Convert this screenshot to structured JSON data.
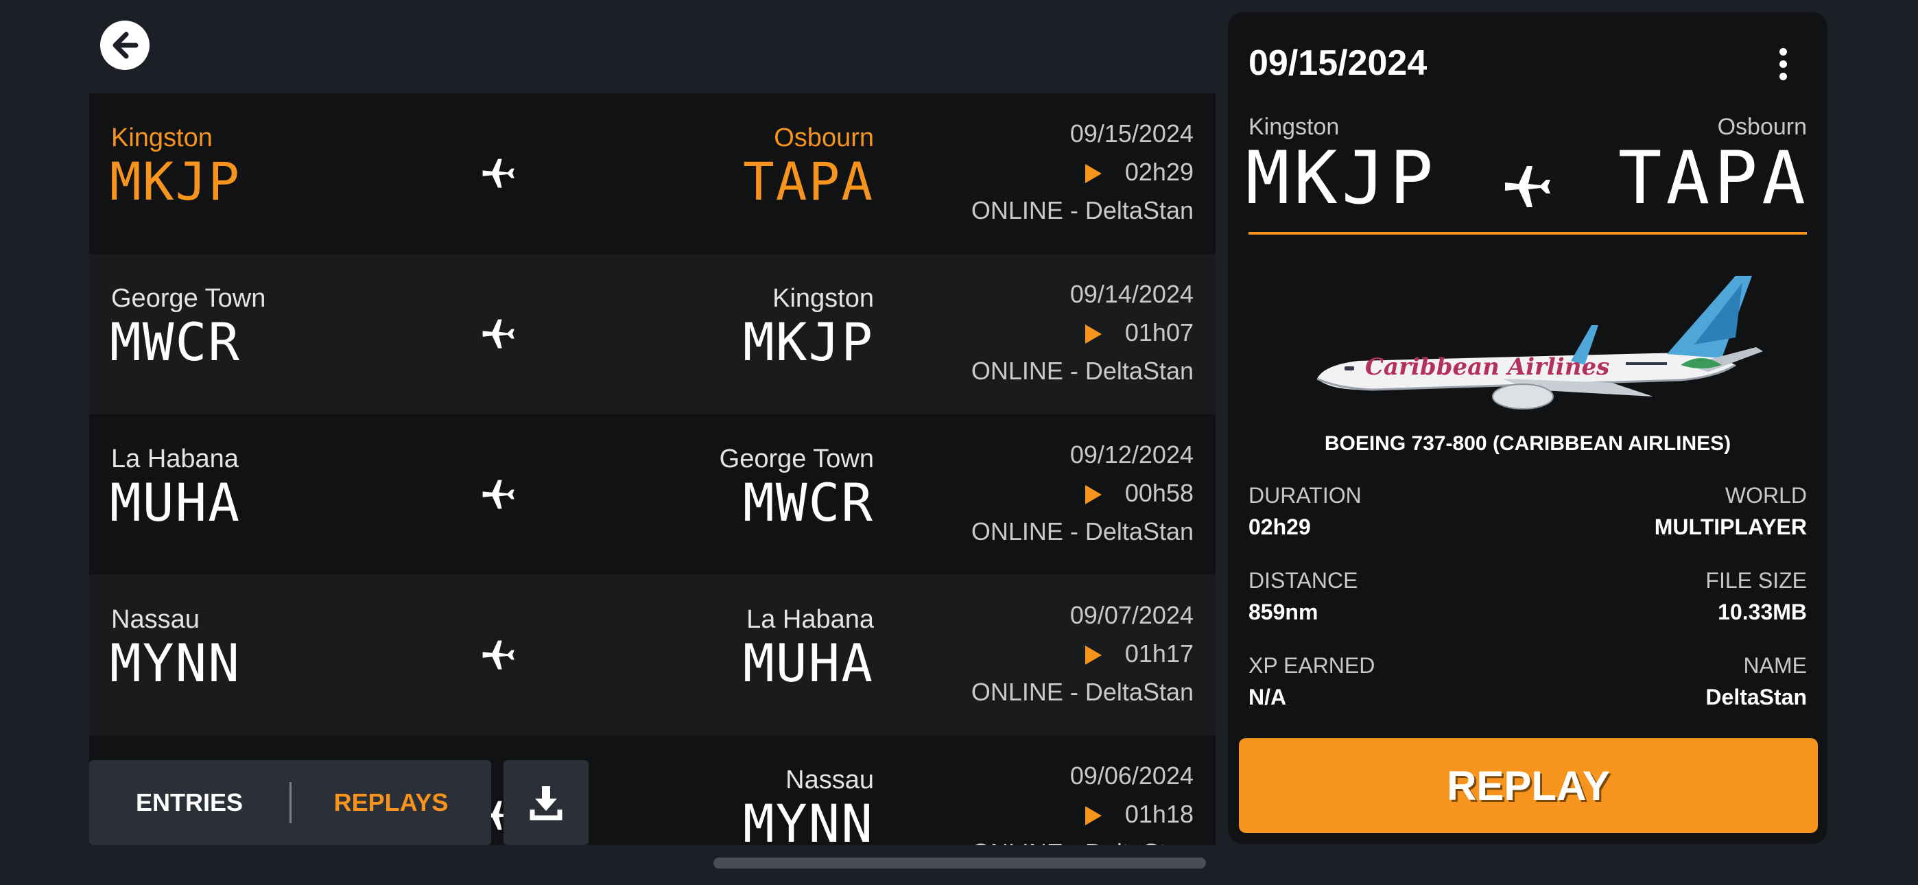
{
  "flights": [
    {
      "dep_city": "Kingston",
      "dep_code": "MKJP",
      "arr_city": "Osbourn",
      "arr_code": "TAPA",
      "date": "09/15/2024",
      "duration": "02h29",
      "status": "ONLINE - DeltaStan",
      "active": true
    },
    {
      "dep_city": "George Town",
      "dep_code": "MWCR",
      "arr_city": "Kingston",
      "arr_code": "MKJP",
      "date": "09/14/2024",
      "duration": "01h07",
      "status": "ONLINE - DeltaStan",
      "active": false
    },
    {
      "dep_city": "La Habana",
      "dep_code": "MUHA",
      "arr_city": "George Town",
      "arr_code": "MWCR",
      "date": "09/12/2024",
      "duration": "00h58",
      "status": "ONLINE - DeltaStan",
      "active": false
    },
    {
      "dep_city": "Nassau",
      "dep_code": "MYNN",
      "arr_city": "La Habana",
      "arr_code": "MUHA",
      "date": "09/07/2024",
      "duration": "01h17",
      "status": "ONLINE - DeltaStan",
      "active": false
    },
    {
      "dep_city": "",
      "dep_code": "",
      "arr_city": "Nassau",
      "arr_code": "MYNN",
      "date": "09/06/2024",
      "duration": "01h18",
      "status": "ONLINE - DeltaStan",
      "active": false
    }
  ],
  "toggle": {
    "entries_label": "ENTRIES",
    "replays_label": "REPLAYS",
    "selected": "REPLAYS"
  },
  "detail": {
    "date": "09/15/2024",
    "dep_city": "Kingston",
    "dep_code": "MKJP",
    "arr_city": "Osbourn",
    "arr_code": "TAPA",
    "aircraft": "BOEING 737-800 (CARIBBEAN AIRLINES)",
    "aircraft_livery_text": "Caribbean Airlines",
    "stats": {
      "duration_label": "DURATION",
      "duration": "02h29",
      "world_label": "WORLD",
      "world": "MULTIPLAYER",
      "distance_label": "DISTANCE",
      "distance": "859nm",
      "filesize_label": "FILE SIZE",
      "filesize": "10.33MB",
      "xp_label": "XP EARNED",
      "xp": "N/A",
      "name_label": "NAME",
      "name": "DeltaStan"
    },
    "replay_label": "REPLAY"
  },
  "colors": {
    "accent": "#f7941d",
    "background": "#1c1f25",
    "row_dark": "#111214",
    "row_light": "#1a1b1d",
    "button": "#2b2f38"
  },
  "icons": {
    "back": "arrow-left-circle-icon",
    "plane": "airplane-icon",
    "play": "play-icon",
    "menu": "more-vertical-icon",
    "download": "download-icon"
  }
}
